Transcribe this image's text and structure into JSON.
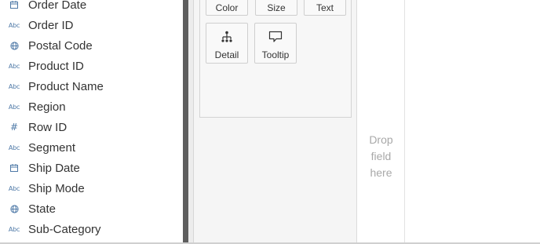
{
  "fields": [
    {
      "label": "Order Date",
      "type": "date",
      "icon": "calendar-icon"
    },
    {
      "label": "Order ID",
      "type": "string",
      "icon": "abc-icon",
      "type_text": "Abc"
    },
    {
      "label": "Postal Code",
      "type": "geo",
      "icon": "globe-icon"
    },
    {
      "label": "Product ID",
      "type": "string",
      "icon": "abc-icon",
      "type_text": "Abc"
    },
    {
      "label": "Product Name",
      "type": "string",
      "icon": "abc-icon",
      "type_text": "Abc"
    },
    {
      "label": "Region",
      "type": "string",
      "icon": "abc-icon",
      "type_text": "Abc"
    },
    {
      "label": "Row ID",
      "type": "number",
      "icon": "hash-icon",
      "type_text": "#"
    },
    {
      "label": "Segment",
      "type": "string",
      "icon": "abc-icon",
      "type_text": "Abc"
    },
    {
      "label": "Ship Date",
      "type": "date",
      "icon": "calendar-icon"
    },
    {
      "label": "Ship Mode",
      "type": "string",
      "icon": "abc-icon",
      "type_text": "Abc"
    },
    {
      "label": "State",
      "type": "geo",
      "icon": "globe-icon"
    },
    {
      "label": "Sub-Category",
      "type": "string",
      "icon": "abc-icon",
      "type_text": "Abc"
    }
  ],
  "marks": {
    "color_label": "Color",
    "size_label": "Size",
    "text_label": "Text",
    "detail_label": "Detail",
    "tooltip_label": "Tooltip"
  },
  "drop_shelf": {
    "line1": "Drop",
    "line2": "field",
    "line3": "here"
  },
  "colors": {
    "field_icon": "#4e79a7",
    "splitter": "#5e5e5e",
    "placeholder_text": "#a8a8a8"
  }
}
